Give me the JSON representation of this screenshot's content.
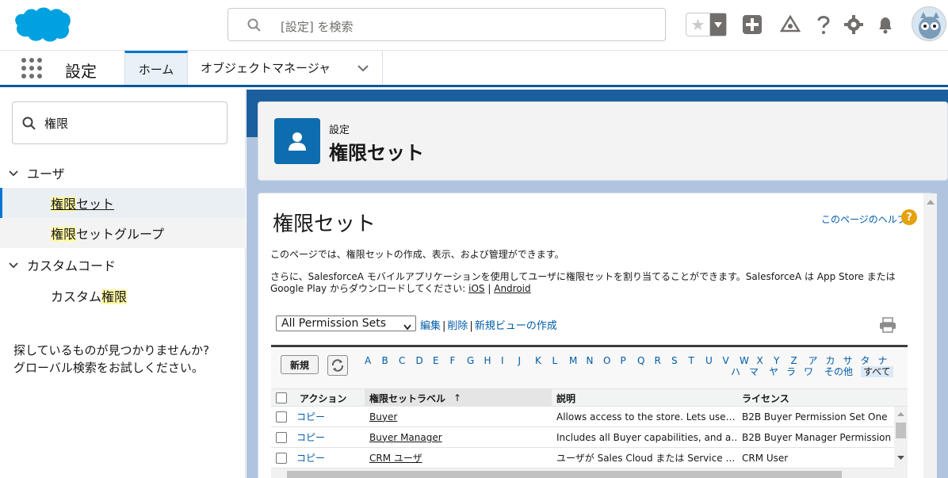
{
  "global_header": {
    "search_placeholder": "[設定] を検索",
    "icons": [
      "salesforce-logo",
      "search-icon",
      "favorites-star-icon",
      "favorites-menu-icon",
      "add-icon",
      "trailhead-icon",
      "help-icon",
      "setup-gear-icon",
      "notifications-bell-icon",
      "user-avatar"
    ]
  },
  "context_bar": {
    "app_name": "設定",
    "tabs": [
      {
        "label": "ホーム"
      },
      {
        "label": "オブジェクトマネージャ"
      }
    ]
  },
  "sidebar": {
    "quickfind_value": "権限",
    "sections": [
      {
        "label": "ユーザ",
        "items": [
          {
            "hl": "権限",
            "rest": "セット"
          },
          {
            "hl": "権限",
            "rest": "セットグループ"
          }
        ]
      },
      {
        "label": "カスタムコード",
        "items": [
          {
            "prefix": "カスタム",
            "hl": "権限"
          }
        ]
      }
    ],
    "help_line1": "探しているものが見つかりませんか?",
    "help_line2": "グローバル検索をお試しください。"
  },
  "page_header": {
    "breadcrumb": "設定",
    "title": "権限セット"
  },
  "content": {
    "title": "権限セット",
    "help_link": "このページのヘルプ",
    "description_1": "このページでは、権限セットの作成、表示、および管理ができます。",
    "description_2": "さらに、SalesforceA モバイルアプリケーションを使用してユーザに権限セットを割り当てることができます。SalesforceA は App Store または Google Play からダウンロードしてください: ",
    "ios_link": "iOS",
    "separator": "|",
    "android_link": "Android",
    "view_select": "All Permission Sets",
    "view_links": {
      "edit": "編集",
      "delete": "削除",
      "new_view": "新規ビューの作成"
    },
    "new_button": "新規",
    "alpha_row1": [
      "A",
      "B",
      "C",
      "D",
      "E",
      "F",
      "G",
      "H",
      "I",
      "J",
      "K",
      "L",
      "M",
      "N",
      "O",
      "P",
      "Q",
      "R",
      "S",
      "T",
      "U",
      "V",
      "W",
      "X",
      "Y",
      "Z",
      "ア",
      "カ",
      "サ",
      "タ",
      "ナ"
    ],
    "alpha_row2": [
      "ハ",
      "マ",
      "ヤ",
      "ラ",
      "ワ",
      "その他",
      "すべて"
    ],
    "grid": {
      "columns": [
        "アクション",
        "権限セットラベル",
        "説明",
        "ライセンス"
      ],
      "sort_indicator": "↑",
      "rows": [
        {
          "action": "コピー",
          "label": "Buyer",
          "description": "Allows access to the store. Lets use…",
          "license": "B2B Buyer Permission Set One"
        },
        {
          "action": "コピー",
          "label": "Buyer Manager",
          "description": "Includes all Buyer capabilities, and a…",
          "license": "B2B Buyer Manager Permission"
        },
        {
          "action": "コピー",
          "label": "CRM ユーザ",
          "description": "ユーザが Sales Cloud または Service …",
          "license": "CRM User"
        }
      ]
    }
  }
}
